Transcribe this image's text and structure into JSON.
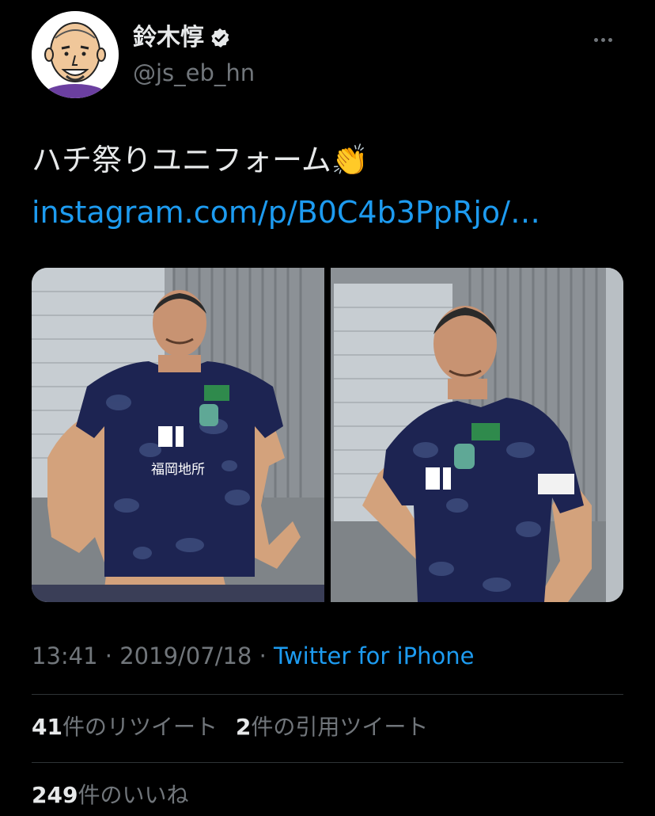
{
  "user": {
    "display_name": "鈴木惇",
    "handle": "@js_eb_hn",
    "verified_icon": "verified-badge-icon",
    "more_icon": "more-horizontal-icon"
  },
  "tweet": {
    "text": "ハチ祭りユニフォーム👏",
    "link": "instagram.com/p/B0C4b3PpRjo/…",
    "photo_1_shirt_text": "福岡地所",
    "photo_1_logo_text": "FJ.",
    "photo_2_logo_text": "FJ."
  },
  "meta": {
    "time": "13:41",
    "separator_1": " · ",
    "date": "2019/07/18",
    "separator_2": " · ",
    "source": "Twitter for iPhone"
  },
  "stats": {
    "retweets_count": "41",
    "retweets_label": "件のリツイート",
    "quotes_count": "2",
    "quotes_label": "件の引用ツイート",
    "likes_count": "249",
    "likes_label": "件のいいね"
  },
  "colors": {
    "background": "#000000",
    "text": "#e7e9ea",
    "secondary": "#71767b",
    "accent": "#1d9bf0",
    "divider": "#2f3336"
  }
}
